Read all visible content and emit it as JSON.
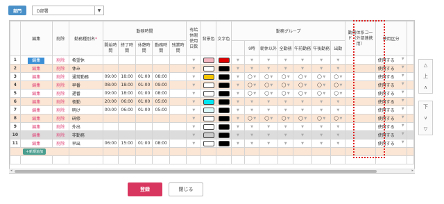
{
  "header": {
    "dept_button": "部門",
    "dept_value": "D部署"
  },
  "columns": {
    "edit": "編集",
    "delete": "削除",
    "type_name": "勤務種別名",
    "required_mark": "*",
    "work_time_group": "勤務時間",
    "start": "開始時間",
    "end": "終了時間",
    "break": "休憩時間",
    "work": "勤務時間",
    "overtime": "残業時間",
    "paid_leave": "有給休暇使用日数",
    "bg_color": "背景色",
    "text_color": "文字色",
    "group": "勤務グループ",
    "g_9": "9時",
    "g_morning": "朝休以外",
    "g_fullday": "全勤務",
    "g_am": "午前勤務",
    "g_pm": "午後勤務",
    "g_out": "出勤",
    "code": "勤務体系コード（外部連携用）",
    "usage": "使用区分"
  },
  "rows": [
    {
      "num": "1",
      "edit": "編集",
      "delete": "削除",
      "name": "希望休",
      "start": "",
      "end": "",
      "break": "",
      "work": "",
      "overtime": "",
      "bg": "#f4b6c0",
      "fg": "#e00000",
      "g": [
        "",
        "",
        "",
        "",
        "",
        ""
      ],
      "usage": "使用する",
      "cls": "odd",
      "editSelected": true
    },
    {
      "num": "2",
      "edit": "編集",
      "delete": "削除",
      "name": "休み",
      "start": "",
      "end": "",
      "break": "",
      "work": "",
      "overtime": "",
      "bg": "#ffffff",
      "fg": "#000000",
      "g": [
        "",
        "",
        "",
        "",
        "",
        ""
      ],
      "usage": "使用する",
      "cls": "even"
    },
    {
      "num": "3",
      "edit": "編集",
      "delete": "削除",
      "name": "通常勤務",
      "start": "09:00",
      "end": "18:00",
      "break": "01:00",
      "work": "08:00",
      "overtime": "",
      "bg": "#f5c400",
      "fg": "#000000",
      "g": [
        "◯",
        "◯",
        "◯",
        "◯",
        "◯",
        "◯"
      ],
      "usage": "使用する",
      "cls": "odd"
    },
    {
      "num": "4",
      "edit": "編集",
      "delete": "削除",
      "name": "早番",
      "start": "08:00",
      "end": "18:00",
      "break": "01:00",
      "work": "09:00",
      "overtime": "",
      "bg": "#ffffff",
      "fg": "#000000",
      "g": [
        "◯",
        "◯",
        "◯",
        "◯",
        "◯",
        "◯"
      ],
      "usage": "使用する",
      "cls": "even"
    },
    {
      "num": "5",
      "edit": "編集",
      "delete": "削除",
      "name": "遅番",
      "start": "09:00",
      "end": "18:00",
      "break": "01:00",
      "work": "08:00",
      "overtime": "",
      "bg": "#ffffff",
      "fg": "#000000",
      "g": [
        "◯",
        "◯",
        "◯",
        "◯",
        "◯",
        "◯"
      ],
      "usage": "使用する",
      "cls": "odd"
    },
    {
      "num": "6",
      "edit": "編集",
      "delete": "削除",
      "name": "夜勤",
      "start": "20:00",
      "end": "06:00",
      "break": "01:00",
      "work": "05:00",
      "overtime": "",
      "bg": "#00e5f0",
      "fg": "#000000",
      "g": [
        "",
        "",
        "",
        "",
        "",
        ""
      ],
      "usage": "使用する",
      "cls": "even"
    },
    {
      "num": "7",
      "edit": "編集",
      "delete": "削除",
      "name": "明け",
      "start": "00:00",
      "end": "06:00",
      "break": "01:00",
      "work": "05:00",
      "overtime": "",
      "bg": "#e0fbfb",
      "fg": "#000000",
      "g": [
        "",
        "",
        "",
        "",
        "",
        ""
      ],
      "usage": "使用する",
      "cls": "odd"
    },
    {
      "num": "8",
      "edit": "編集",
      "delete": "削除",
      "name": "研修",
      "start": "",
      "end": "",
      "break": "",
      "work": "",
      "overtime": "",
      "bg": "#ffffff",
      "fg": "#000000",
      "g": [
        "◯",
        "◯",
        "◯",
        "◯",
        "◯",
        "◯"
      ],
      "usage": "使用する",
      "cls": "even"
    },
    {
      "num": "9",
      "edit": "編集",
      "delete": "削除",
      "name": "外出",
      "start": "",
      "end": "",
      "break": "",
      "work": "",
      "overtime": "",
      "bg": "#ffffff",
      "fg": "#000000",
      "g": [
        "",
        "",
        "",
        "",
        "",
        ""
      ],
      "usage": "使用する",
      "cls": "odd"
    },
    {
      "num": "10",
      "edit": "編集",
      "delete": "削除",
      "name": "非勤務",
      "start": "",
      "end": "",
      "break": "",
      "work": "",
      "overtime": "",
      "bg": "#cccccc",
      "fg": "#000000",
      "g": [
        "",
        "",
        "",
        "",
        "",
        ""
      ],
      "usage": "使用する",
      "cls": "grey"
    },
    {
      "num": "11",
      "edit": "編集",
      "delete": "削除",
      "name": "早出",
      "start": "06:00",
      "end": "15:00",
      "break": "01:00",
      "work": "08:00",
      "overtime": "",
      "bg": "#ffffff",
      "fg": "#000000",
      "g": [
        "",
        "",
        "",
        "",
        "",
        ""
      ],
      "usage": "使用する",
      "cls": "odd"
    }
  ],
  "add_row_label": "＋新規追加",
  "side": {
    "top": [
      "△",
      "上",
      "∧"
    ],
    "bottom": [
      "下",
      "∨",
      "▽"
    ]
  },
  "footer": {
    "register": "登録",
    "close": "閉じる"
  },
  "colors": {
    "accent": "#4a90c8",
    "register": "#d9365f",
    "row_alt": "#fbe5d4",
    "highlight_box": "#e02020"
  }
}
